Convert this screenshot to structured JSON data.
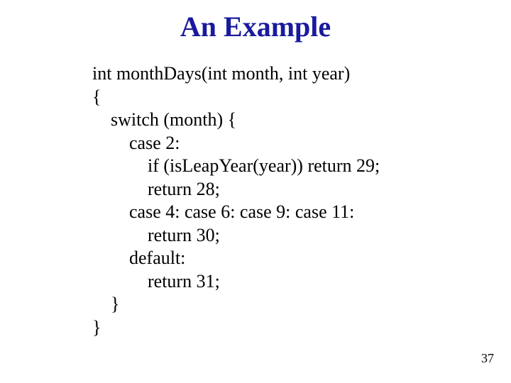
{
  "title": "An Example",
  "code": {
    "l1": "int monthDays(int month, int year)",
    "l2": "{",
    "l3": "    switch (month) {",
    "l4": "        case 2:",
    "l5": "            if (isLeapYear(year)) return 29;",
    "l6": "            return 28;",
    "l7": "        case 4: case 6: case 9: case 11:",
    "l8": "            return 30;",
    "l9": "        default:",
    "l10": "            return 31;",
    "l11": "    }",
    "l12": "}"
  },
  "page_number": "37"
}
